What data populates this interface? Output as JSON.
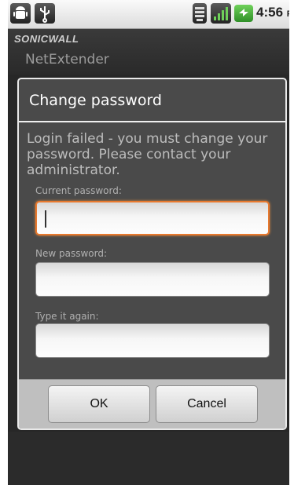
{
  "status_bar": {
    "icons": [
      "android-debug-icon",
      "usb-icon",
      "wifi-icon",
      "signal-icon",
      "battery-icon"
    ],
    "time": "4:56",
    "ampm": "PM"
  },
  "app": {
    "logo_text": "SONICWALL",
    "title": "NetExtender"
  },
  "dialog": {
    "title": "Change password",
    "message": "Login failed - you must change your password.  Please contact your administrator.",
    "fields": [
      {
        "label": "Current password:",
        "value": "",
        "focused": true
      },
      {
        "label": "New password:",
        "value": "",
        "focused": false
      },
      {
        "label": "Type it again:",
        "value": "",
        "focused": false
      }
    ],
    "ok_label": "OK",
    "cancel_label": "Cancel"
  },
  "colors": {
    "focus_accent": "#e8792e",
    "dialog_bg": "#4a4a4a",
    "title_bar_bg": "#2a2a2a"
  }
}
